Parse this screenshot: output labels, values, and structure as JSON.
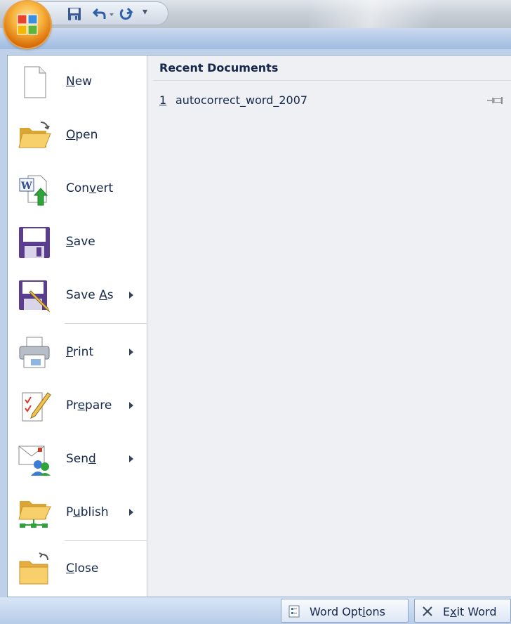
{
  "quick_access": {
    "customize_glyph": "▾"
  },
  "office_button": {
    "icon": "office-logo-icon"
  },
  "menu": {
    "items": [
      {
        "label": "New",
        "accelerator": "N",
        "icon": "new-document-icon",
        "submenu": false
      },
      {
        "label": "Open",
        "accelerator": "O",
        "icon": "open-folder-icon",
        "submenu": false
      },
      {
        "label": "Convert",
        "accelerator": "v",
        "icon": "convert-document-icon",
        "submenu": false
      },
      {
        "label": "Save",
        "accelerator": "S",
        "icon": "save-disk-icon",
        "submenu": false
      },
      {
        "label": "Save As",
        "accelerator": "A",
        "icon": "save-as-icon",
        "submenu": true
      },
      {
        "label": "Print",
        "accelerator": "P",
        "icon": "printer-icon",
        "submenu": true
      },
      {
        "label": "Prepare",
        "accelerator": "e",
        "icon": "prepare-document-icon",
        "submenu": true
      },
      {
        "label": "Send",
        "accelerator": "d",
        "icon": "send-email-icon",
        "submenu": true
      },
      {
        "label": "Publish",
        "accelerator": "u",
        "icon": "publish-folder-icon",
        "submenu": true
      },
      {
        "label": "Close",
        "accelerator": "C",
        "icon": "close-folder-icon",
        "submenu": false
      }
    ]
  },
  "recent": {
    "title": "Recent Documents",
    "documents": [
      {
        "number": "1",
        "name": "autocorrect_word_2007",
        "pinned": false
      }
    ]
  },
  "footer": {
    "options_label": "Word Options",
    "options_accel": "i",
    "exit_label": "Exit Word",
    "exit_accel": "x"
  }
}
